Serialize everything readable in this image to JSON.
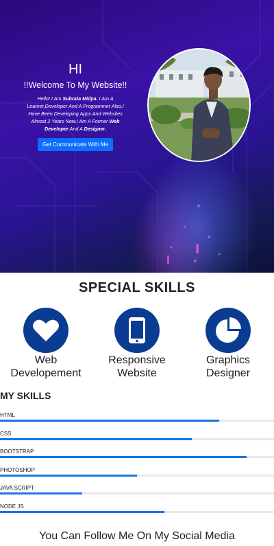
{
  "hero": {
    "greeting": "HI",
    "welcome": "!!Welcome To My Website!!",
    "intro": {
      "p1": "Hello! I Am ",
      "name": "Subrata Midya.",
      "p2": " I Am A Learner,Developer And A Programmer Also.I Have Been Developing Apps And Websites Almost 2 Years Now.I Am A Former ",
      "role1": "Web Developer",
      "p3": " And A ",
      "role2": "Designer."
    },
    "cta_label": "Get Communicate With Me",
    "colors": {
      "button": "#0d6efd",
      "background": "#2a0a7a"
    }
  },
  "special_skills": {
    "title": "SPECIAL SKILLS",
    "cards": [
      {
        "icon": "heart-icon",
        "label_line1": "Web",
        "label_line2": "Developement"
      },
      {
        "icon": "mobile-phone-icon",
        "label_line1": "Responsive",
        "label_line2": "Website"
      },
      {
        "icon": "pie-chart-icon",
        "label_line1": "Graphics",
        "label_line2": "Designer"
      }
    ],
    "icon_color": "#0a3d91"
  },
  "my_skills": {
    "title": "MY SKILLS",
    "items": [
      {
        "name": "HTML",
        "level": 0.8
      },
      {
        "name": "CSS",
        "level": 0.7
      },
      {
        "name": "BOOTSTRAP",
        "level": 0.9
      },
      {
        "name": "PHOTOSHOP",
        "level": 0.5
      },
      {
        "name": "JAVA SCRIPT",
        "level": 0.3
      },
      {
        "name": "NODE JS",
        "level": 0.6
      }
    ],
    "bar_color": "#1a73e8"
  },
  "social": {
    "heading": "You Can Follow Me On My Social Media"
  }
}
